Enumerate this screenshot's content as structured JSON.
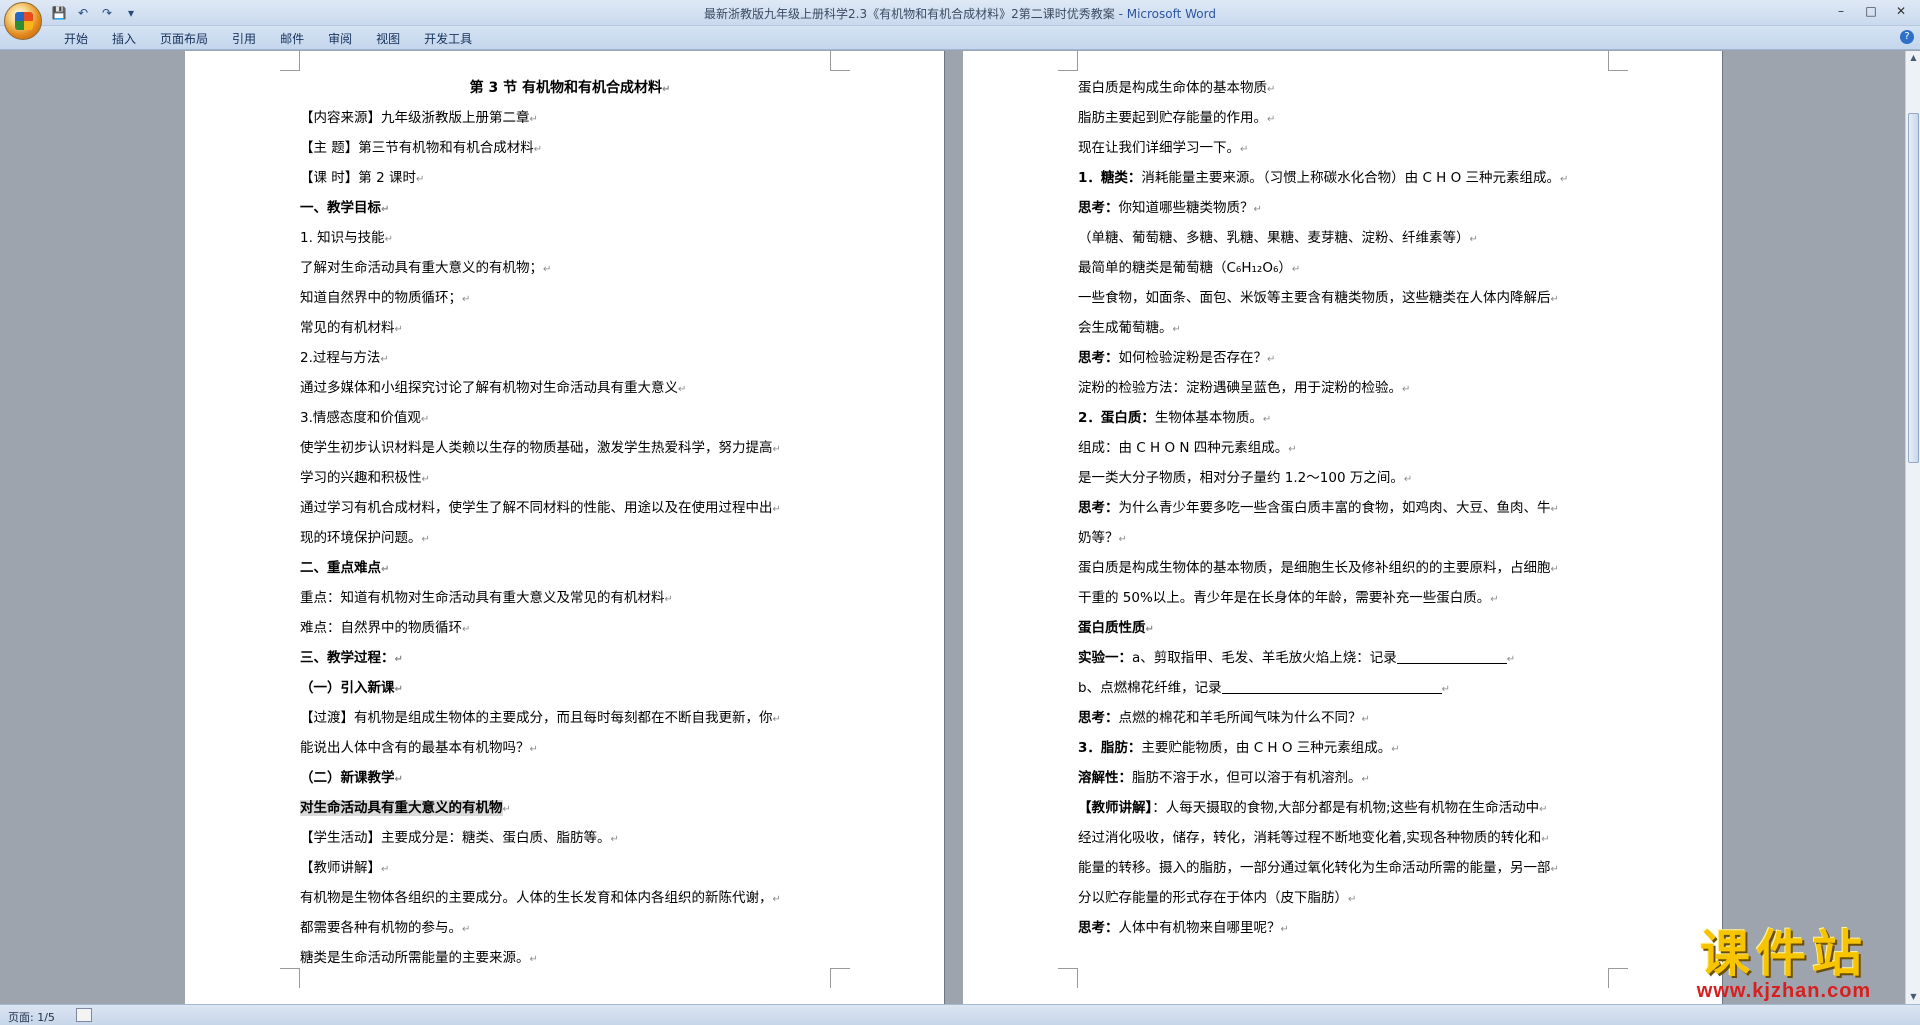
{
  "window": {
    "title": "最新浙教版九年级上册科学2.3《有机物和有机合成材料》2第二课时优秀教案",
    "app_suffix": " - Microsoft Word",
    "controls": [
      "–",
      "□",
      "✕"
    ]
  },
  "qat": {
    "save": "💾",
    "undo": "↶",
    "redo": "↷",
    "more": "▾"
  },
  "ribbon": {
    "tabs": [
      "开始",
      "插入",
      "页面布局",
      "引用",
      "邮件",
      "审阅",
      "视图",
      "开发工具"
    ]
  },
  "page_left": {
    "lines": [
      {
        "text": "第 3 节    有机物和有机合成材料",
        "style": "title"
      },
      {
        "text": "【内容来源】九年级浙教版上册第二章"
      },
      {
        "text": "【主      题】第三节有机物和有机合成材料"
      },
      {
        "text": "【课      时】第 2 课时"
      },
      {
        "text": "一、教学目标",
        "style": "bold"
      },
      {
        "text": "1. 知识与技能"
      },
      {
        "text": "了解对生命活动具有重大意义的有机物；"
      },
      {
        "text": "知道自然界中的物质循环；"
      },
      {
        "text": "常见的有机材料"
      },
      {
        "text": "2.过程与方法"
      },
      {
        "text": "通过多媒体和小组探究讨论了解有机物对生命活动具有重大意义"
      },
      {
        "text": "3.情感态度和价值观"
      },
      {
        "text": "使学生初步认识材料是人类赖以生存的物质基础，激发学生热爱科学，努力提高"
      },
      {
        "text": "学习的兴趣和积极性"
      },
      {
        "text": "通过学习有机合成材料，使学生了解不同材料的性能、用途以及在使用过程中出"
      },
      {
        "text": "现的环境保护问题。"
      },
      {
        "text": "二、重点难点",
        "style": "bold"
      },
      {
        "text": "重点：知道有机物对生命活动具有重大意义及常见的有机材料"
      },
      {
        "text": "难点：自然界中的物质循环"
      },
      {
        "text": "三、教学过程：",
        "style": "bold"
      },
      {
        "text": "（一）引入新课",
        "style": "bold"
      },
      {
        "text": "【过渡】有机物是组成生物体的主要成分，而且每时每刻都在不断自我更新，你"
      },
      {
        "text": "能说出人体中含有的最基本有机物吗？"
      },
      {
        "text": "（二）新课教学",
        "style": "bold"
      },
      {
        "text": "对生命活动具有重大意义的有机物",
        "style": "highlight"
      },
      {
        "text": "【学生活动】主要成分是：糖类、蛋白质、脂肪等。"
      },
      {
        "text": "【教师讲解】"
      },
      {
        "text": "有机物是生物体各组织的主要成分。人体的生长发育和体内各组织的新陈代谢，"
      },
      {
        "text": "都需要各种有机物的参与。"
      },
      {
        "text": "糖类是生命活动所需能量的主要来源。"
      }
    ]
  },
  "page_right": {
    "lines": [
      {
        "text": "蛋白质是构成生命体的基本物质"
      },
      {
        "text": "脂肪主要起到贮存能量的作用。"
      },
      {
        "text": "现在让我们详细学习一下。"
      },
      {
        "lead": "1．糖类：",
        "text": "消耗能量主要来源。（习惯上称碳水化合物）由 C H O 三种元素组成。"
      },
      {
        "lead": "思考：",
        "text": "你知道哪些糖类物质？"
      },
      {
        "text": "（单糖、葡萄糖、多糖、乳糖、果糖、麦芽糖、淀粉、纤维素等）"
      },
      {
        "text": "最简单的糖类是葡萄糖（C₆H₁₂O₆）"
      },
      {
        "text": "一些食物，如面条、面包、米饭等主要含有糖类物质，这些糖类在人体内降解后"
      },
      {
        "text": "会生成葡萄糖。"
      },
      {
        "lead": "思考：",
        "text": "如何检验淀粉是否存在？"
      },
      {
        "text": "淀粉的检验方法：淀粉遇碘呈蓝色，用于淀粉的检验。"
      },
      {
        "lead": "2．蛋白质：",
        "text": "生物体基本物质。"
      },
      {
        "text": " 组成：由 C H O N 四种元素组成。"
      },
      {
        "text": "是一类大分子物质，相对分子量约 1.2～100 万之间。"
      },
      {
        "lead": "思考：",
        "text": "为什么青少年要多吃一些含蛋白质丰富的食物，如鸡肉、大豆、鱼肉、牛"
      },
      {
        "text": "奶等？"
      },
      {
        "text": "蛋白质是构成生物体的基本物质，是细胞生长及修补组织的的主要原料，占细胞"
      },
      {
        "text": "干重的 50%以上。青少年是在长身体的年龄，需要补充一些蛋白质。"
      },
      {
        "text": "蛋白质性质",
        "style": "bold"
      },
      {
        "lead": "实验一：",
        "text": "a、剪取指甲、毛发、羊毛放火焰上烧：记录",
        "blank": 1
      },
      {
        "text": "b、点燃棉花纤维，记录",
        "blank": 2
      },
      {
        "lead": "思考：",
        "text": "点燃的棉花和羊毛所闻气味为什么不同？"
      },
      {
        "lead": "3．脂肪：",
        "text": "主要贮能物质，由 C H O 三种元素组成。"
      },
      {
        "lead": "溶解性：",
        "text": "脂肪不溶于水，但可以溶于有机溶剂。"
      },
      {
        "lead": "【教师讲解】",
        "text": "：人每天摄取的食物,大部分都是有机物;这些有机物在生命活动中"
      },
      {
        "text": "经过消化吸收，储存，转化，消耗等过程不断地变化着,实现各种物质的转化和"
      },
      {
        "text": "能量的转移。摄入的脂肪，一部分通过氧化转化为生命活动所需的能量，另一部"
      },
      {
        "text": "分以贮存能量的形式存在于体内（皮下脂肪）"
      },
      {
        "lead": "思考：",
        "text": "人体中有机物来自哪里呢？"
      }
    ]
  },
  "status": {
    "page": "页面: 1/5"
  },
  "watermark": {
    "main": "课件站",
    "url": "www.kjzhan.com"
  },
  "paragraph_mark": "↵"
}
